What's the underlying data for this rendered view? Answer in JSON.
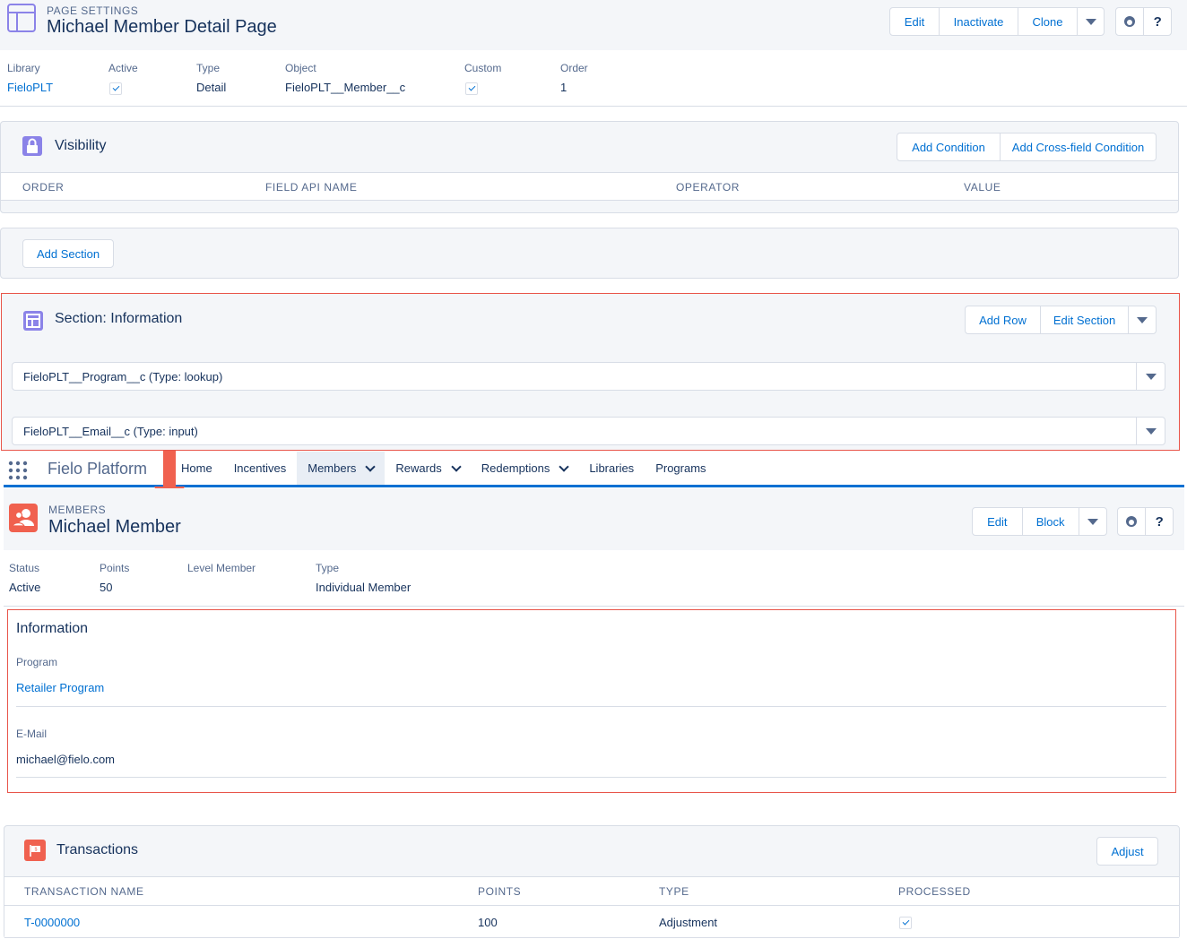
{
  "page_settings": {
    "eyebrow": "PAGE SETTINGS",
    "title": "Michael Member Detail Page",
    "buttons": [
      "Edit",
      "Inactivate",
      "Clone"
    ],
    "help_glyph": "?",
    "fields": [
      {
        "label": "Library",
        "value": "FieloPLT"
      },
      {
        "label": "Active",
        "checked": true
      },
      {
        "label": "Type",
        "value": "Detail"
      },
      {
        "label": "Object",
        "value": "FieloPLT__Member__c"
      },
      {
        "label": "Custom",
        "checked": true
      },
      {
        "label": "Order",
        "value": "1"
      }
    ]
  },
  "visibility": {
    "title": "Visibility",
    "buttons": [
      "Add Condition",
      "Add Cross-field Condition"
    ],
    "columns": [
      "ORDER",
      "FIELD API NAME",
      "OPERATOR",
      "VALUE"
    ]
  },
  "add_section": {
    "label": "Add Section"
  },
  "section": {
    "title": "Section: Information",
    "buttons": [
      "Add Row",
      "Edit Section"
    ],
    "rows": [
      "FieloPLT__Program__c (Type: lookup)",
      "FieloPLT__Email__c (Type: input)"
    ]
  },
  "nav": {
    "app_name": "Fielo Platform",
    "items": [
      {
        "label": "Home",
        "chevron": false,
        "active": false
      },
      {
        "label": "Incentives",
        "chevron": false,
        "active": false
      },
      {
        "label": "Members",
        "chevron": true,
        "active": true
      },
      {
        "label": "Rewards",
        "chevron": true,
        "active": false
      },
      {
        "label": "Redemptions",
        "chevron": true,
        "active": false
      },
      {
        "label": "Libraries",
        "chevron": false,
        "active": false
      },
      {
        "label": "Programs",
        "chevron": false,
        "active": false
      }
    ]
  },
  "member": {
    "eyebrow": "MEMBERS",
    "title": "Michael Member",
    "buttons": [
      "Edit",
      "Block"
    ],
    "help_glyph": "?",
    "fields": [
      {
        "label": "Status",
        "value": "Active"
      },
      {
        "label": "Points",
        "value": "50"
      },
      {
        "label": "Level Member",
        "value": ""
      },
      {
        "label": "Type",
        "value": "Individual Member"
      }
    ]
  },
  "information": {
    "title": "Information",
    "fields": [
      {
        "label": "Program",
        "value": "Retailer Program",
        "link": true
      },
      {
        "label": "E-Mail",
        "value": "michael@fielo.com",
        "link": false
      }
    ]
  },
  "transactions": {
    "title": "Transactions",
    "button": "Adjust",
    "columns": [
      "TRANSACTION NAME",
      "POINTS",
      "TYPE",
      "PROCESSED"
    ],
    "rows": [
      {
        "name": "T-0000000",
        "points": "100",
        "type": "Adjustment",
        "processed": true
      }
    ]
  },
  "colors": {
    "link": "#0070d2",
    "text": "#16325c",
    "highlight_border": "#e8554a",
    "arrow": "#f0614f",
    "page_icon": "#8b83e8",
    "member_icon": "#f0614f",
    "nav_underline": "#0070d2"
  }
}
